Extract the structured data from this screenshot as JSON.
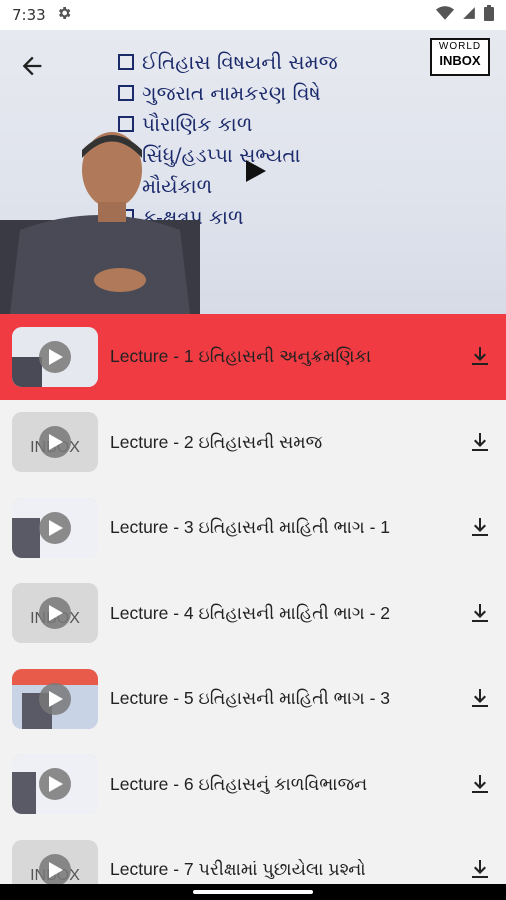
{
  "status_bar": {
    "time": "7:33"
  },
  "video": {
    "board_items": [
      "ઈતિહાસ વિષયની સમજ",
      "ગુજરાત નામકરણ વિષે",
      "પૌરાણિક કાળ",
      "સિંધુ/હડપ્પા સભ્યતા",
      "મૌર્યકાળ",
      "ક-ક્ષત્રપ કાળ"
    ],
    "logo_top": "WORLD",
    "logo_bottom": "INBOX"
  },
  "lectures": [
    {
      "title": "Lecture - 1 ઇતિહાસની અનુક્રમણિકા",
      "active": true
    },
    {
      "title": "Lecture - 2 ઇતિહાસની સમજ",
      "active": false
    },
    {
      "title": "Lecture - 3  ઇતિહાસની માહિતી ભાગ - 1",
      "active": false
    },
    {
      "title": "Lecture - 4 ઇતિહાસની માહિતી ભાગ - 2",
      "active": false
    },
    {
      "title": "Lecture - 5  ઇતિહાસની માહિતી ભાગ - 3",
      "active": false
    },
    {
      "title": "Lecture - 6 ઇતિહાસનું કાળવિભાજન",
      "active": false
    },
    {
      "title": "Lecture - 7 પરીક્ષામાં પુછાયેલા પ્રશ્નો",
      "active": false
    }
  ],
  "colors": {
    "active_row": "#f13b43",
    "board_text": "#1b2a6b"
  }
}
